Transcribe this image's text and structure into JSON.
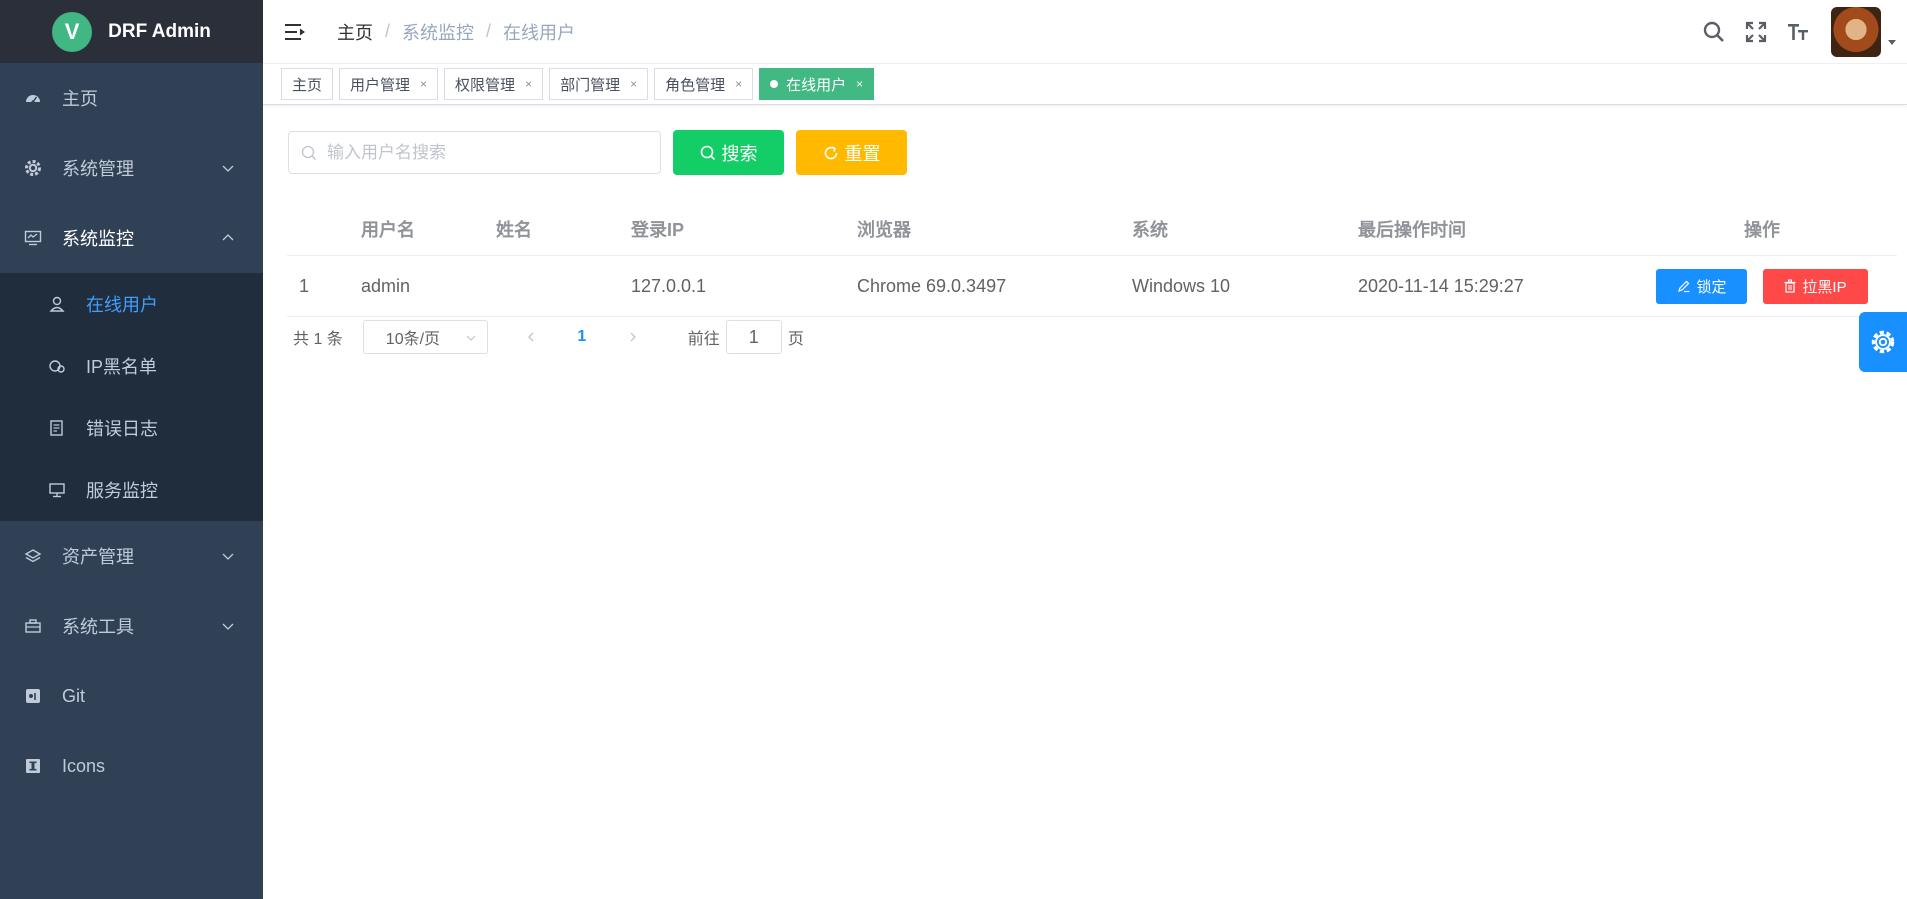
{
  "app": {
    "logo_letter": "V",
    "title": "DRF Admin",
    "colors": {
      "sidebar_bg": "#304156",
      "submenu_bg": "#1f2d3d",
      "active": "#409eff",
      "tag_active": "#42b983"
    }
  },
  "sidebar": {
    "items": [
      {
        "label": "主页",
        "icon": "dashboard-icon"
      },
      {
        "label": "系统管理",
        "icon": "gear-icon",
        "expandable": true
      },
      {
        "label": "系统监控",
        "icon": "monitor-icon",
        "expandable": true,
        "expanded": true,
        "children": [
          {
            "label": "在线用户",
            "icon": "online-user-icon",
            "active": true
          },
          {
            "label": "IP黑名单",
            "icon": "ip-blacklist-icon"
          },
          {
            "label": "错误日志",
            "icon": "error-log-icon"
          },
          {
            "label": "服务监控",
            "icon": "server-monitor-icon"
          }
        ]
      },
      {
        "label": "资产管理",
        "icon": "layers-icon",
        "expandable": true
      },
      {
        "label": "系统工具",
        "icon": "toolbox-icon",
        "expandable": true
      },
      {
        "label": "Git",
        "icon": "git-icon"
      },
      {
        "label": "Icons",
        "icon": "icons-icon"
      }
    ]
  },
  "header": {
    "breadcrumb": [
      "主页",
      "系统监控",
      "在线用户"
    ],
    "breadcrumb_sep": "/",
    "icons": [
      "search-icon",
      "fullscreen-icon",
      "font-size-icon",
      "avatar",
      "caret-down-icon"
    ]
  },
  "tags": [
    {
      "label": "主页",
      "closable": false
    },
    {
      "label": "用户管理",
      "closable": true
    },
    {
      "label": "权限管理",
      "closable": true
    },
    {
      "label": "部门管理",
      "closable": true
    },
    {
      "label": "角色管理",
      "closable": true
    },
    {
      "label": "在线用户",
      "closable": true,
      "active": true
    }
  ],
  "tag_close_glyph": "×",
  "search": {
    "placeholder": "输入用户名搜索",
    "value": "",
    "search_label": "搜索",
    "reset_label": "重置"
  },
  "table": {
    "columns": [
      "",
      "用户名",
      "姓名",
      "登录IP",
      "浏览器",
      "系统",
      "最后操作时间",
      "操作"
    ],
    "rows": [
      {
        "index": "1",
        "username": "admin",
        "name": "",
        "ip": "127.0.0.1",
        "browser": "Chrome 69.0.3497",
        "os": "Windows 10",
        "last_time": "2020-11-14 15:29:27",
        "lock_label": "锁定",
        "ban_label": "拉黑IP"
      }
    ]
  },
  "pagination": {
    "total_text": "共 1 条",
    "page_size": "10条/页",
    "current_page": "1",
    "goto_prefix": "前往",
    "goto_value": "1",
    "goto_suffix": "页"
  }
}
